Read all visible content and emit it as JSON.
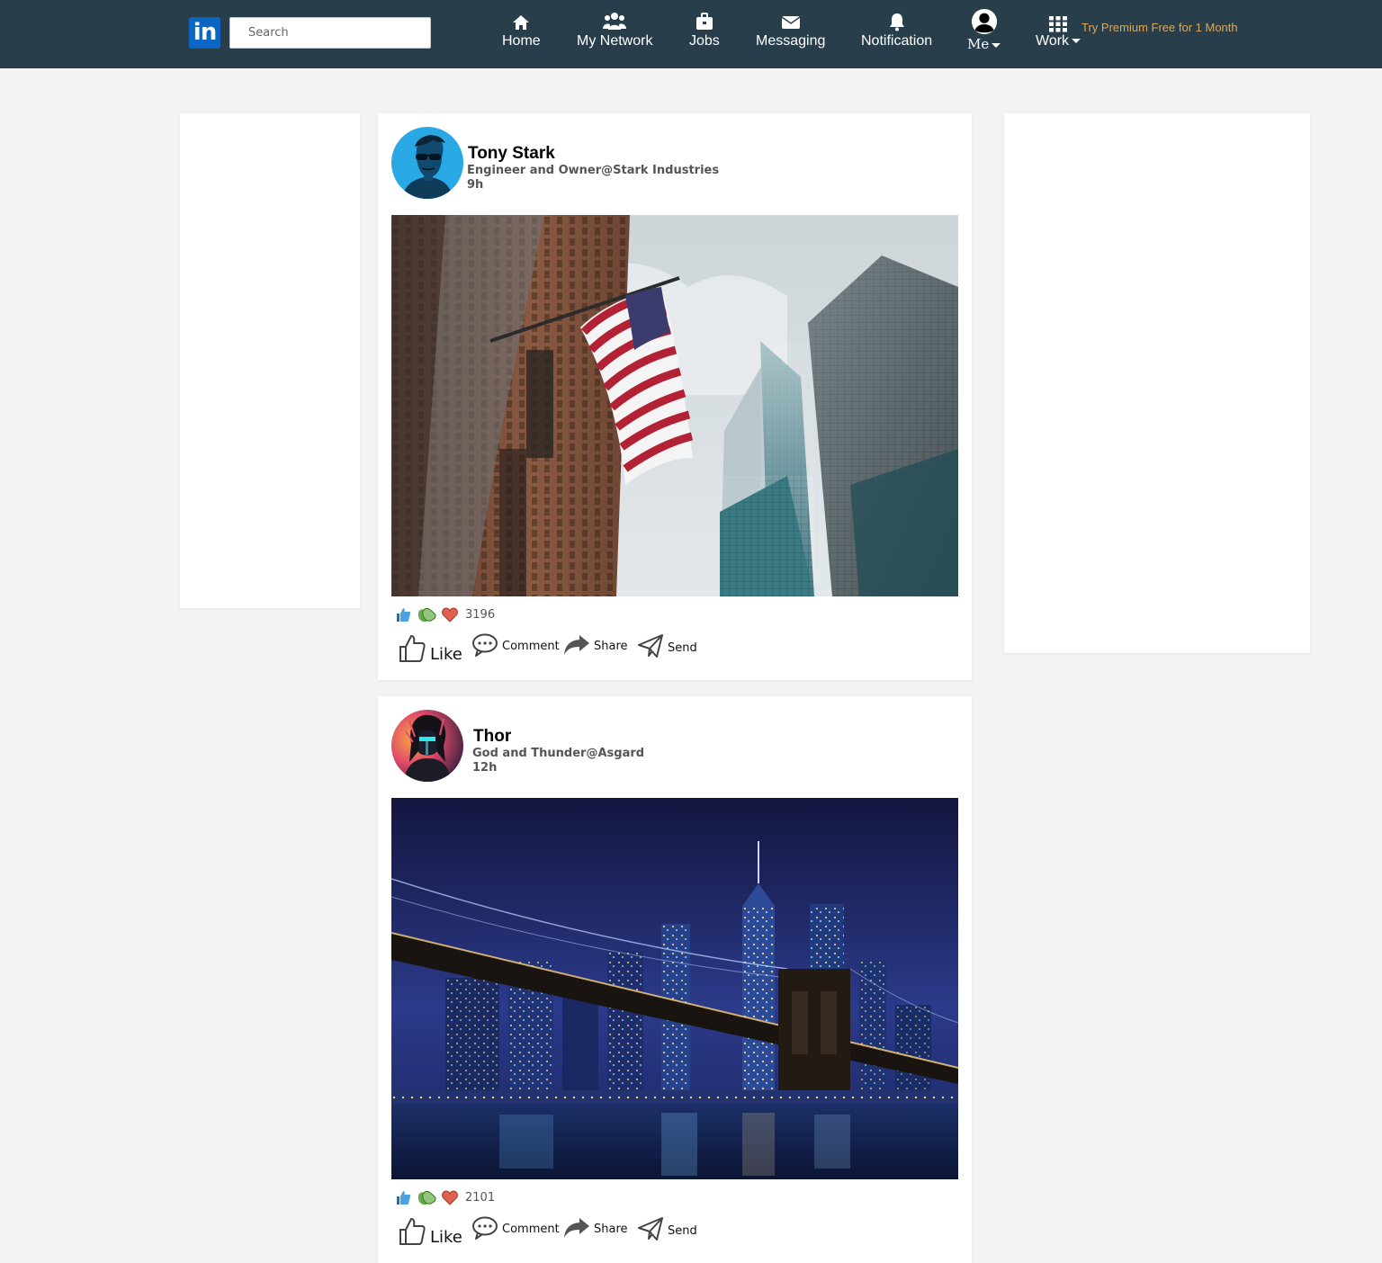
{
  "nav": {
    "logo_text": "in",
    "search_placeholder": "Search",
    "items": [
      {
        "label": "Home",
        "icon": "home-icon"
      },
      {
        "label": "My Network",
        "icon": "network-icon"
      },
      {
        "label": "Jobs",
        "icon": "briefcase-icon"
      },
      {
        "label": "Messaging",
        "icon": "envelope-icon"
      },
      {
        "label": "Notification",
        "icon": "bell-icon"
      },
      {
        "label": "Me",
        "icon": "user-avatar-icon"
      },
      {
        "label": "Work",
        "icon": "grid-icon"
      }
    ],
    "premium": "Try Premium Free for 1 Month"
  },
  "posts": [
    {
      "author": "Tony Stark",
      "headline": "Engineer and Owner@Stark Industries",
      "time": "9h",
      "reaction_count": "3196",
      "image": "city-skyscrapers-flag-photo"
    },
    {
      "author": "Thor",
      "headline": "God and Thunder@Asgard",
      "time": "12h",
      "reaction_count": "2101",
      "image": "night-bridge-skyline-photo"
    }
  ],
  "actions": {
    "like": "Like",
    "comment": "Comment",
    "share": "Share",
    "send": "Send"
  },
  "colors": {
    "navbar": "#283e4a",
    "background": "#f3f3f3",
    "brand": "#0a66c2",
    "premium": "#d9a85f"
  }
}
